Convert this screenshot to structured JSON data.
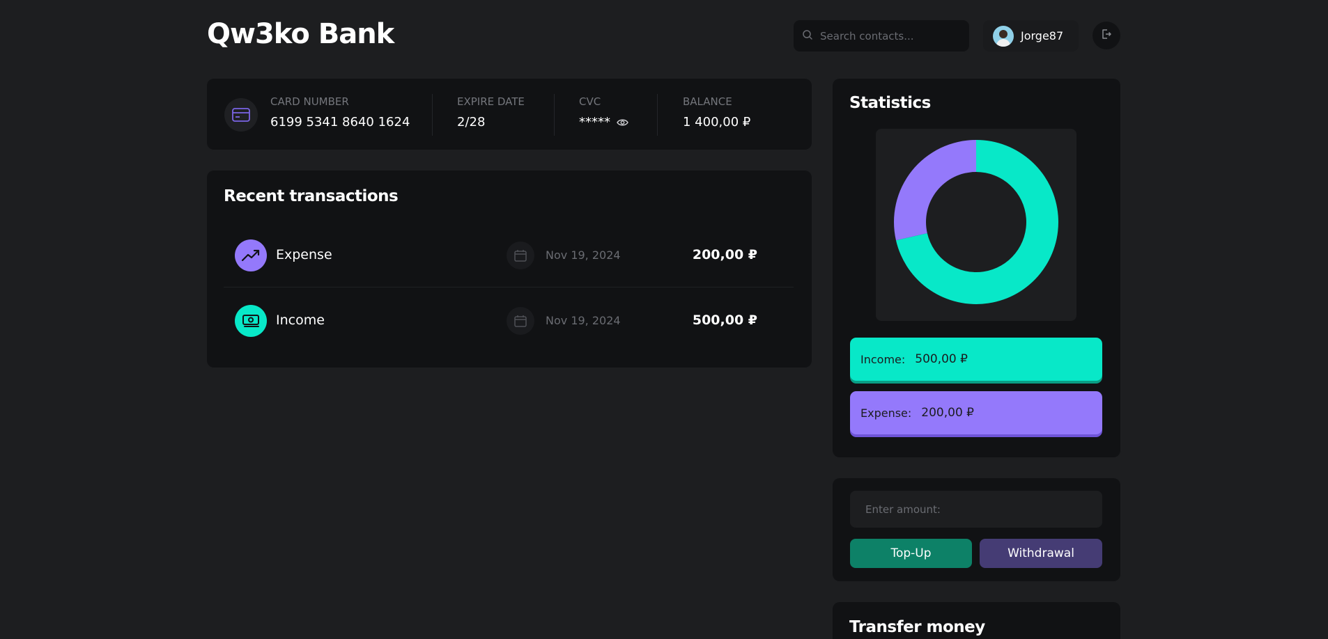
{
  "header": {
    "logo": "Qw3ko Bank",
    "search_placeholder": "Search contacts...",
    "username": "Jorge87"
  },
  "card": {
    "number_label": "CARD NUMBER",
    "number": "6199 5341 8640 1624",
    "expire_label": "EXPIRE DATE",
    "expire": "2/28",
    "cvc_label": "CVC",
    "cvc": "*****",
    "balance_label": "BALANCE",
    "balance": "1 400,00 ₽"
  },
  "transactions": {
    "title": "Recent transactions",
    "items": [
      {
        "type": "Expense",
        "date": "Nov 19, 2024",
        "amount": "200,00 ₽",
        "icon": "trending-up-icon",
        "color": "#9479fb"
      },
      {
        "type": "Income",
        "date": "Nov 19, 2024",
        "amount": "500,00 ₽",
        "icon": "cash-icon",
        "color": "#08e8c8"
      }
    ]
  },
  "statistics": {
    "title": "Statistics",
    "income_label": "Income:",
    "income_value": "500,00 ₽",
    "expense_label": "Expense:",
    "expense_value": "200,00 ₽",
    "colors": {
      "income": "#08e8c8",
      "expense": "#9479fb"
    }
  },
  "chart_data": {
    "type": "pie",
    "categories": [
      "Income",
      "Expense"
    ],
    "values": [
      500,
      200
    ],
    "colors": [
      "#08e8c8",
      "#9479fb"
    ]
  },
  "amount_panel": {
    "placeholder": "Enter amount:",
    "topup_label": "Top-Up",
    "withdraw_label": "Withdrawal"
  },
  "transfer": {
    "title": "Transfer money"
  }
}
